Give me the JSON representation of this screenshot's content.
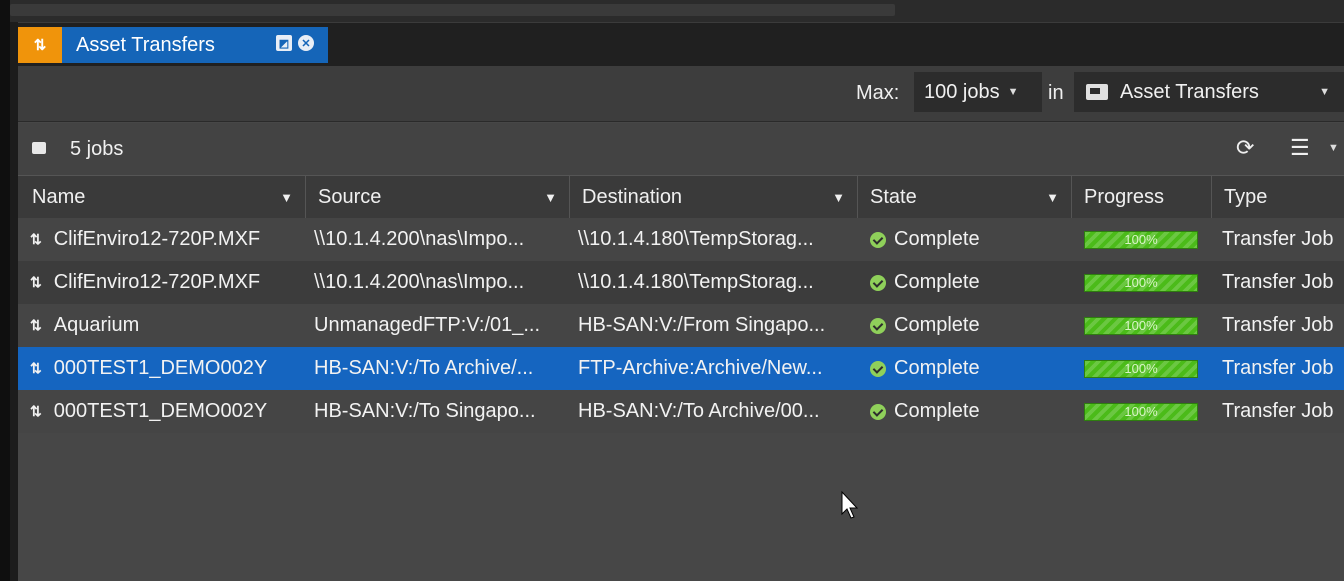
{
  "tab": {
    "title": "Asset Transfers"
  },
  "toolbar": {
    "max_label": "Max:",
    "max_value": "100 jobs",
    "in_label": "in",
    "destination": "Asset Transfers"
  },
  "jobs": {
    "count_label": "5 jobs"
  },
  "columns": [
    "Name",
    "Source",
    "Destination",
    "State",
    "Progress",
    "Type"
  ],
  "rows": [
    {
      "name": "ClifEnviro12-720P.MXF",
      "source": "\\\\10.1.4.200\\nas\\Impo...",
      "destination": "\\\\10.1.4.180\\TempStorag...",
      "state": "Complete",
      "progress_label": "100%",
      "progress_fraction": 1.0,
      "type": "Transfer Job",
      "selected": false
    },
    {
      "name": "ClifEnviro12-720P.MXF",
      "source": "\\\\10.1.4.200\\nas\\Impo...",
      "destination": "\\\\10.1.4.180\\TempStorag...",
      "state": "Complete",
      "progress_label": "100%",
      "progress_fraction": 1.0,
      "type": "Transfer Job",
      "selected": false
    },
    {
      "name": "Aquarium",
      "source": "UnmanagedFTP:V:/01_...",
      "destination": "HB-SAN:V:/From Singapo...",
      "state": "Complete",
      "progress_label": "100%",
      "progress_fraction": 1.0,
      "type": "Transfer Job",
      "selected": false
    },
    {
      "name": "000TEST1_DEMO002Y",
      "source": "HB-SAN:V:/To Archive/...",
      "destination": "FTP-Archive:Archive/New...",
      "state": "Complete",
      "progress_label": "100%",
      "progress_fraction": 1.0,
      "type": "Transfer Job",
      "selected": true
    },
    {
      "name": "000TEST1_DEMO002Y",
      "source": "HB-SAN:V:/To Singapo...",
      "destination": "HB-SAN:V:/To Archive/00...",
      "state": "Complete",
      "progress_label": "100%",
      "progress_fraction": 1.0,
      "type": "Transfer Job",
      "selected": false
    }
  ],
  "colors": {
    "accent_orange": "#f0940b",
    "selection_blue": "#1565c0",
    "progress_green": "#4bbb19",
    "complete_green": "#8fd05a"
  }
}
